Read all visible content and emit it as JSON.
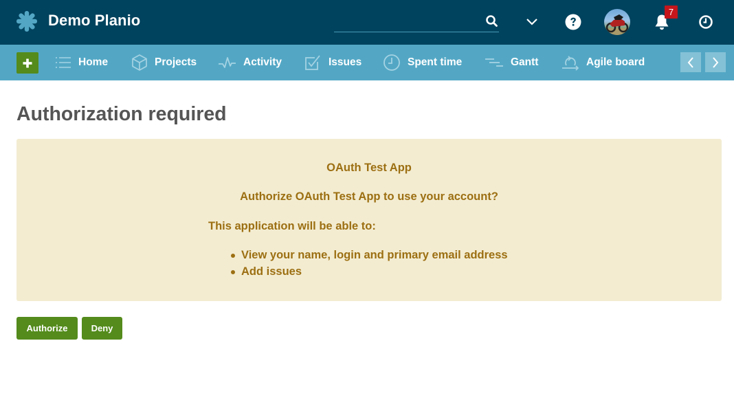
{
  "header": {
    "app_title": "Demo Planio",
    "search": {
      "placeholder": "",
      "value": ""
    },
    "notifications_count": "7",
    "icons": [
      "logo-icon",
      "search-icon",
      "chevron-down-icon",
      "help-icon",
      "avatar",
      "bell-icon",
      "clock-icon"
    ]
  },
  "nav": {
    "add_label": "+",
    "items": [
      {
        "label": "Home",
        "icon": "list-icon"
      },
      {
        "label": "Projects",
        "icon": "cube-icon"
      },
      {
        "label": "Activity",
        "icon": "activity-icon"
      },
      {
        "label": "Issues",
        "icon": "checkbox-icon"
      },
      {
        "label": "Spent time",
        "icon": "clock-icon"
      },
      {
        "label": "Gantt",
        "icon": "gantt-icon"
      },
      {
        "label": "Agile board",
        "icon": "agile-icon"
      }
    ]
  },
  "main": {
    "title": "Authorization required",
    "app_name": "OAuth Test App",
    "question": "Authorize OAuth Test App to use your account?",
    "able_to": "This application will be able to:",
    "permissions": [
      "View your name, login and primary email address",
      "Add issues"
    ],
    "authorize_label": "Authorize",
    "deny_label": "Deny"
  },
  "colors": {
    "topbar": "#00435e",
    "navbar": "#53a7c5",
    "accent_green": "#548b1c",
    "notice_bg": "#f3ecd1",
    "notice_text": "#9c6f12",
    "badge": "#c4161c"
  }
}
